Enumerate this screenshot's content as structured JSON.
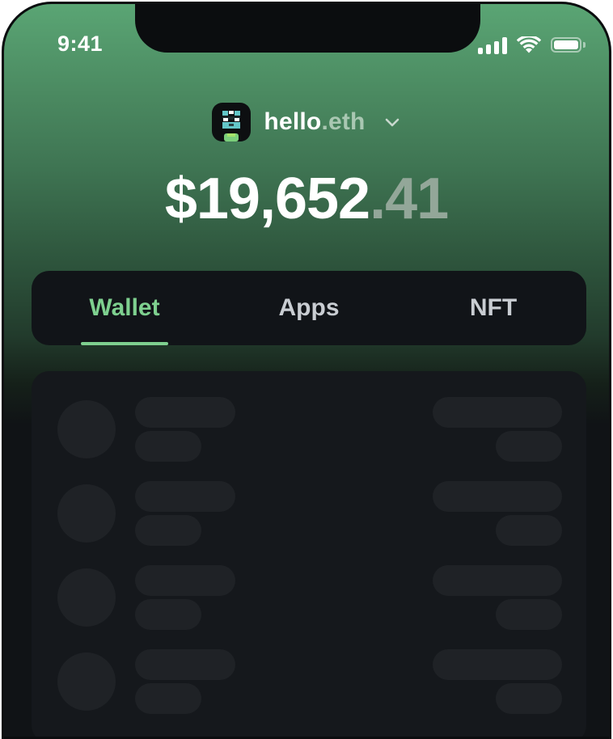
{
  "status_bar": {
    "time": "9:41",
    "icons": [
      "signal-icon",
      "wifi-icon",
      "battery-icon"
    ]
  },
  "account": {
    "name": "hello",
    "suffix": ".eth",
    "avatar_icon": "avatar-icon",
    "dropdown_icon": "chevron-down-icon"
  },
  "balance": {
    "whole": "$19,652",
    "cents": ".41"
  },
  "tabs": [
    {
      "label": "Wallet",
      "active": true
    },
    {
      "label": "Apps",
      "active": false
    },
    {
      "label": "NFT",
      "active": false
    }
  ],
  "list": {
    "state": "loading",
    "placeholder_rows": 4
  },
  "colors": {
    "accent": "#7ed08f",
    "gradient_top": "#5aa574",
    "background": "#101316",
    "card": "#111418",
    "skeleton": "#1f2226"
  }
}
